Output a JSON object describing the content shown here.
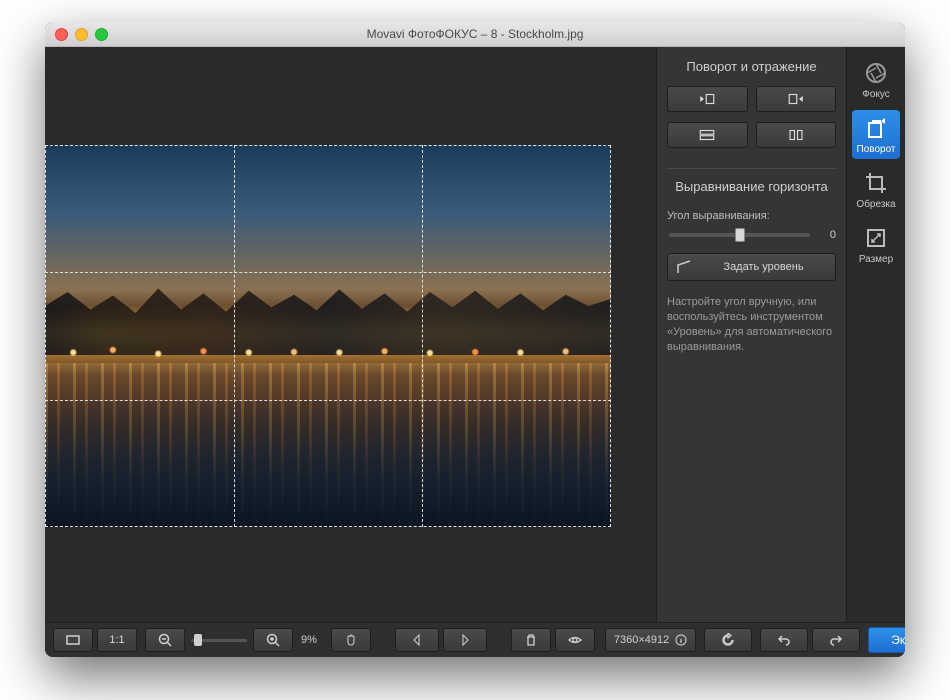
{
  "window": {
    "title": "Movavi ФотоФОКУС – 8 - Stockholm.jpg"
  },
  "sidebar": {
    "tools": [
      {
        "id": "focus",
        "label": "Фокус",
        "active": false
      },
      {
        "id": "rotate",
        "label": "Поворот",
        "active": true
      },
      {
        "id": "crop",
        "label": "Обрезка",
        "active": false
      },
      {
        "id": "resize",
        "label": "Размер",
        "active": false
      }
    ]
  },
  "panel": {
    "rotate_title": "Поворот и отражение",
    "horizon_title": "Выравнивание горизонта",
    "angle_label": "Угол выравнивания:",
    "angle_value": "0",
    "set_level_btn": "Задать уровень",
    "help_text": "Настройте угол вручную, или воспользуйтесь инструментом «Уровень» для автоматического выравнивания."
  },
  "bottombar": {
    "fit_label": "1:1",
    "zoom_value": "9%",
    "dimensions": "7360×4912",
    "export_label": "Экспорт"
  },
  "colors": {
    "accent": "#2d8fe8"
  }
}
